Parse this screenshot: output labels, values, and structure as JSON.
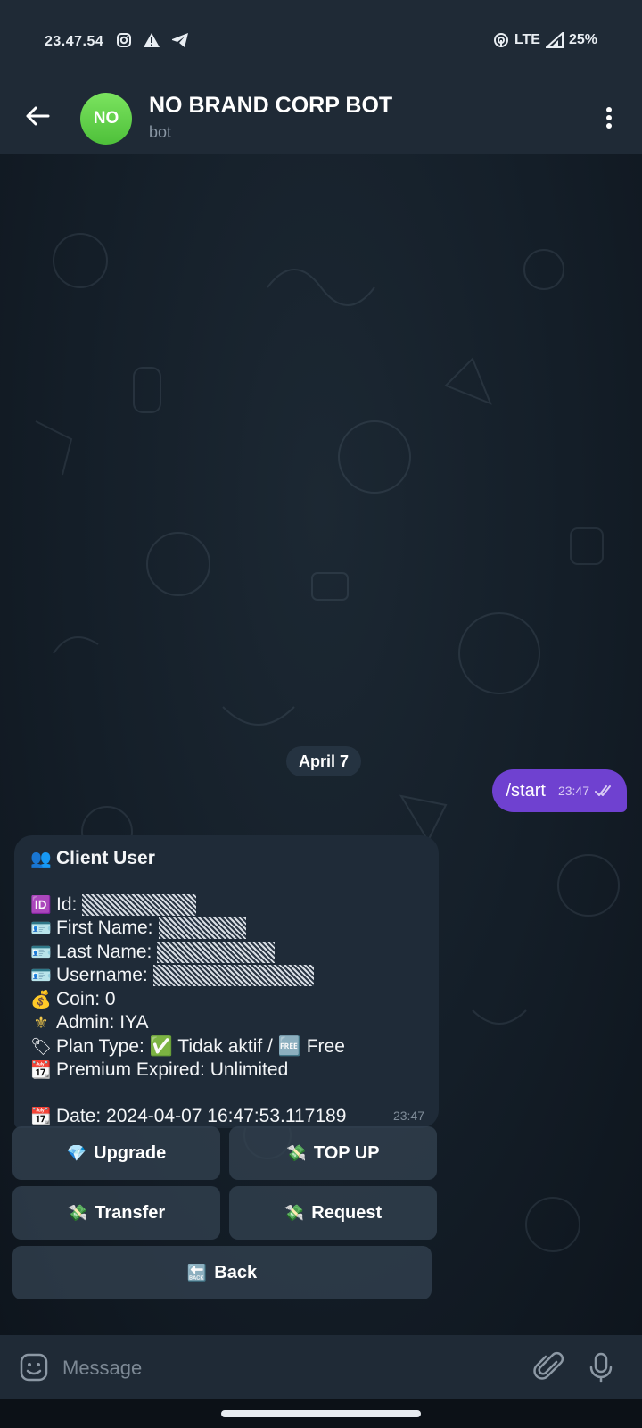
{
  "status_bar": {
    "time": "23.47.54",
    "network": "LTE",
    "battery": "25%"
  },
  "header": {
    "avatar_initials": "NO",
    "title": "NO BRAND CORP BOT",
    "subtitle": "bot"
  },
  "chat": {
    "date_separator": "April 7",
    "outgoing": {
      "text": "/start",
      "time": "23:47"
    },
    "incoming": {
      "time": "23:47",
      "lines": [
        {
          "icon": "👥",
          "text": "Client User",
          "bold": true
        },
        {
          "icon": "🆔",
          "text": "Id:"
        },
        {
          "icon": "🪪",
          "text": "First Name:"
        },
        {
          "icon": "🪪",
          "text": "Last Name:"
        },
        {
          "icon": "🪪",
          "text": "Username:"
        },
        {
          "icon": "💰",
          "text": "Coin: 0"
        },
        {
          "icon": "⚜",
          "text": "Admin: IYA"
        },
        {
          "icon": "🏷",
          "text": "Plan Type: ✅ Tidak aktif / 🆓 Free"
        },
        {
          "icon": "📆",
          "text": "Premium Expired: Unlimited"
        },
        {
          "icon": "📆",
          "text": "Date: 2024-04-07 16:47:53.117189"
        }
      ]
    },
    "keyboard": [
      {
        "icon": "💎",
        "label": "Upgrade"
      },
      {
        "icon": "💸",
        "label": "TOP UP"
      },
      {
        "icon": "💸",
        "label": "Transfer"
      },
      {
        "icon": "💸",
        "label": "Request"
      },
      {
        "icon": "🔙",
        "label": "Back"
      }
    ]
  },
  "input_bar": {
    "placeholder": "Message"
  },
  "colors": {
    "header_bg": "#1f2a36",
    "outgoing_bubble": "#6f41d0",
    "incoming_bubble": "#1f2b38",
    "avatar_green": "#5ccb45"
  }
}
